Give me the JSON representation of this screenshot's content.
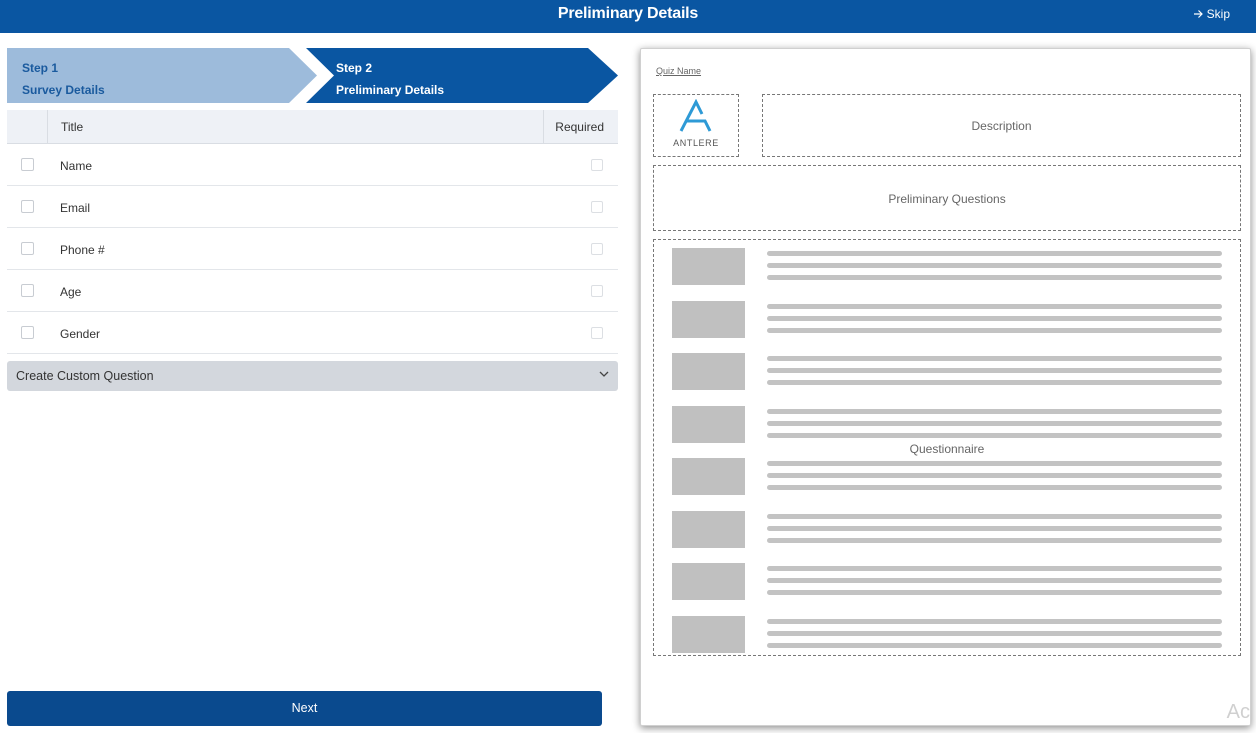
{
  "header": {
    "title": "Preliminary Details",
    "skip_label": "Skip"
  },
  "stepper": {
    "steps": [
      {
        "num": "Step 1",
        "label": "Survey Details",
        "state": "complete",
        "color": "#9dbbdb"
      },
      {
        "num": "Step 2",
        "label": "Preliminary Details",
        "state": "active",
        "color": "#0a56a2"
      }
    ]
  },
  "table": {
    "columns": {
      "title": "Title",
      "required": "Required"
    },
    "rows": [
      {
        "label": "Name"
      },
      {
        "label": "Email"
      },
      {
        "label": "Phone #"
      },
      {
        "label": "Age"
      },
      {
        "label": "Gender"
      }
    ]
  },
  "custom_question": {
    "label": "Create Custom Question"
  },
  "next_button": {
    "label": "Next"
  },
  "preview": {
    "quiz_name": "Quiz Name",
    "logo_text": "ANTLERE",
    "description": "Description",
    "preliminary_questions": "Preliminary Questions",
    "questionnaire": "Questionnaire",
    "placeholder_rows": 8
  },
  "watermark": "Ac",
  "colors": {
    "brand": "#0a56a2",
    "step_done": "#9dbbdb",
    "logo_accent": "#2e9ad6"
  }
}
